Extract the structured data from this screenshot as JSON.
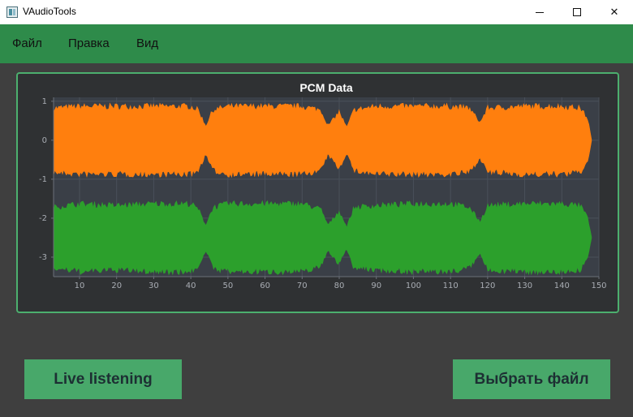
{
  "window": {
    "title": "VAudioTools",
    "minimize_icon": "minimize-icon",
    "maximize_icon": "maximize-icon",
    "close_icon": "close-icon"
  },
  "menu": {
    "items": [
      {
        "label": "Файл"
      },
      {
        "label": "Правка"
      },
      {
        "label": "Вид"
      }
    ]
  },
  "colors": {
    "menubar": "#2e8b4a",
    "background": "#3f3f3f",
    "button": "#48a86a",
    "chart_border": "#4caf6e",
    "plot_bg": "#3a3f47"
  },
  "chart_data": {
    "type": "area",
    "title": "PCM Data",
    "xlim": [
      3,
      150
    ],
    "ylim": [
      -3.5,
      1.1
    ],
    "x_ticks": [
      10,
      20,
      30,
      40,
      50,
      60,
      70,
      80,
      90,
      100,
      110,
      120,
      130,
      140,
      150
    ],
    "y_ticks": [
      1,
      0,
      -1,
      -2,
      -3
    ],
    "grid": true,
    "series": [
      {
        "color": "#ff7f0e",
        "center": 0,
        "x": [
          3,
          10,
          20,
          30,
          40,
          42,
          44,
          46,
          50,
          60,
          70,
          75,
          77,
          80,
          82,
          84,
          90,
          100,
          110,
          115,
          118,
          120,
          130,
          140,
          145,
          147,
          148
        ],
        "amplitude": [
          0.9,
          0.95,
          0.95,
          0.95,
          0.95,
          0.85,
          0.4,
          0.85,
          0.95,
          0.95,
          0.95,
          0.85,
          0.4,
          0.8,
          0.35,
          0.85,
          0.95,
          0.95,
          0.95,
          0.9,
          0.5,
          0.9,
          0.95,
          0.95,
          0.9,
          0.6,
          0.02
        ]
      },
      {
        "color": "#2ca02c",
        "center": -2.5,
        "x": [
          3,
          10,
          20,
          30,
          40,
          42,
          44,
          46,
          50,
          60,
          70,
          75,
          77,
          80,
          82,
          84,
          90,
          100,
          110,
          115,
          118,
          120,
          130,
          140,
          145,
          147,
          148
        ],
        "amplitude": [
          0.85,
          0.95,
          0.9,
          0.95,
          0.95,
          0.8,
          0.35,
          0.85,
          0.95,
          0.95,
          0.95,
          0.8,
          0.35,
          0.75,
          0.3,
          0.85,
          0.9,
          0.95,
          0.95,
          0.85,
          0.45,
          0.9,
          0.95,
          0.95,
          0.9,
          0.55,
          0.02
        ]
      }
    ]
  },
  "buttons": {
    "live": "Live listening",
    "file": "Выбрать файл"
  }
}
